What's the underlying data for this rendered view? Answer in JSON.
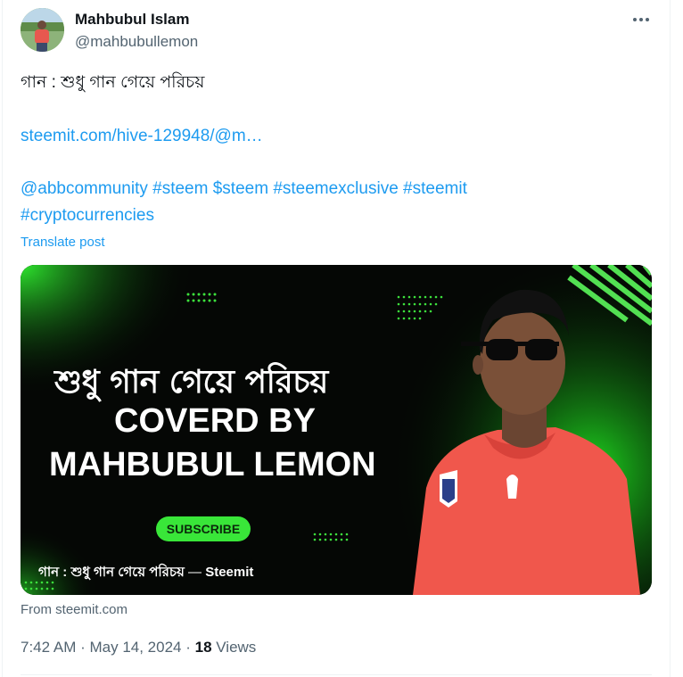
{
  "author": {
    "display_name": "Mahbubul Islam",
    "handle": "@mahbubullemon"
  },
  "post": {
    "text": "গান : শুধু গান গেয়ে পরিচয়",
    "link": "steemit.com/hive-129948/@m…",
    "tags_line1": [
      "@abbcommunity",
      "#steem",
      "$steem",
      "#steemexclusive",
      "#steemit"
    ],
    "tags_line2": [
      "#cryptocurrencies"
    ],
    "translate_label": "Translate post"
  },
  "card": {
    "title_bn": "শুধু গান গেয়ে পরিচয়",
    "title_en_line1": "COVERD BY",
    "title_en_line2": "MAHBUBUL LEMON",
    "subscribe_label": "SUBSCRIBE",
    "caption": "গান : শুধু গান গেয়ে পরিচয়",
    "caption_sep": " — ",
    "caption_source": "Steemit",
    "source_label": "From steemit.com"
  },
  "meta": {
    "time": "7:42 AM",
    "dot1": " · ",
    "date": "May 14, 2024",
    "dot2": " · ",
    "views_count": "18",
    "views_label": " Views"
  },
  "colors": {
    "link": "#1d9bf0",
    "muted": "#536471",
    "accent_green": "#39e639"
  },
  "icons": {
    "more": "more-horizontal-icon"
  }
}
